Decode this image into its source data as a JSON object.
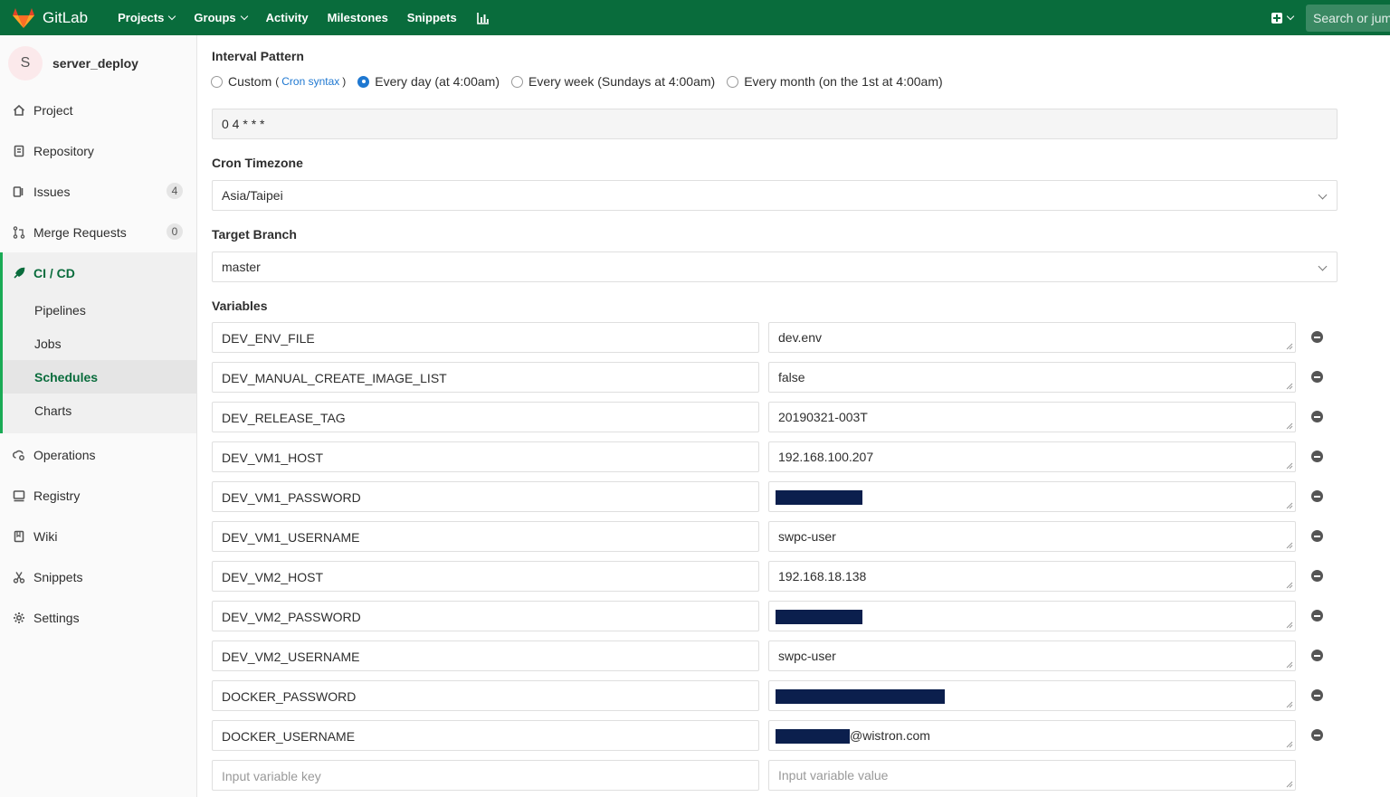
{
  "topbar": {
    "brand": "GitLab",
    "nav": [
      "Projects",
      "Groups",
      "Activity",
      "Milestones",
      "Snippets"
    ],
    "search_placeholder": "Search or jump to…"
  },
  "sidebar": {
    "avatar_letter": "S",
    "project_name": "server_deploy",
    "items": [
      {
        "label": "Project",
        "icon": "home-icon"
      },
      {
        "label": "Repository",
        "icon": "doc-icon"
      },
      {
        "label": "Issues",
        "icon": "issues-icon",
        "badge": "4"
      },
      {
        "label": "Merge Requests",
        "icon": "merge-request-icon",
        "badge": "0"
      },
      {
        "label": "CI / CD",
        "icon": "rocket-icon"
      },
      {
        "label": "Operations",
        "icon": "cloud-gear-icon"
      },
      {
        "label": "Registry",
        "icon": "registry-icon"
      },
      {
        "label": "Wiki",
        "icon": "book-icon"
      },
      {
        "label": "Snippets",
        "icon": "scissors-icon"
      },
      {
        "label": "Settings",
        "icon": "gear-icon"
      }
    ],
    "cicd_sub": [
      "Pipelines",
      "Jobs",
      "Schedules",
      "Charts"
    ],
    "active_sub": "Schedules"
  },
  "form": {
    "interval_label": "Interval Pattern",
    "radio_custom": "Custom",
    "cron_syntax": "Cron syntax",
    "radio_day": "Every day (at 4:00am)",
    "radio_week": "Every week (Sundays at 4:00am)",
    "radio_month": "Every month (on the 1st at 4:00am)",
    "selected_interval": "day",
    "cron_value": "0 4 * * *",
    "timezone_label": "Cron Timezone",
    "timezone_value": "Asia/Taipei",
    "branch_label": "Target Branch",
    "branch_value": "master",
    "variables_label": "Variables",
    "key_placeholder": "Input variable key",
    "value_placeholder": "Input variable value"
  },
  "variables": [
    {
      "key": "DEV_ENV_FILE",
      "value": "dev.env"
    },
    {
      "key": "DEV_MANUAL_CREATE_IMAGE_LIST",
      "value": "false"
    },
    {
      "key": "DEV_RELEASE_TAG",
      "value": "20190321-003T"
    },
    {
      "key": "DEV_VM1_HOST",
      "value": "192.168.100.207"
    },
    {
      "key": "DEV_VM1_PASSWORD",
      "value": ""
    },
    {
      "key": "DEV_VM1_USERNAME",
      "value": "swpc-user"
    },
    {
      "key": "DEV_VM2_HOST",
      "value": "192.168.18.138"
    },
    {
      "key": "DEV_VM2_PASSWORD",
      "value": ""
    },
    {
      "key": "DEV_VM2_USERNAME",
      "value": "swpc-user"
    },
    {
      "key": "DOCKER_PASSWORD",
      "value": ""
    },
    {
      "key": "DOCKER_USERNAME",
      "value": "@wistron.com"
    }
  ],
  "colors": {
    "brand_green": "#096c3c",
    "accent_blue": "#1f78d1",
    "redaction": "#0b1f4d"
  }
}
